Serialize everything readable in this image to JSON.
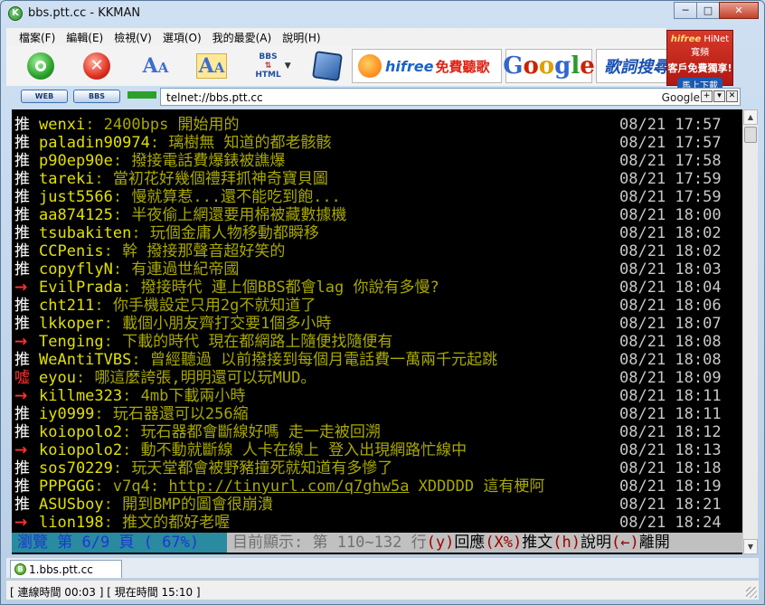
{
  "window": {
    "title": "bbs.ptt.cc - KKMAN",
    "minimize": "─",
    "maximize": "□",
    "close": "✕"
  },
  "menu": [
    "檔案(F)",
    "編輯(E)",
    "檢視(V)",
    "選項(O)",
    "我的最愛(A)",
    "說明(H)"
  ],
  "toolbar": {
    "bbs_html_label": "BBS",
    "bbs_html_label2": "HTML",
    "hifree_brand": "hifree",
    "hifree_text": "免費聽歌",
    "google_ad": "Google",
    "lyric_ad": "歌詞搜尋"
  },
  "banner": {
    "brand": "hifree",
    "line1": "HiNet寬頻",
    "line2": "客戶免費獨享!",
    "cta": "馬上下載"
  },
  "address": {
    "web_label": "WEB",
    "bbs_label": "BBS",
    "value": "telnet://bbs.ptt.cc",
    "search_engine": "Google"
  },
  "posts": [
    {
      "tag": "推",
      "type": "push",
      "user": "wenxi",
      "msg": "2400bps 開始用的",
      "date": "08/21 17:57"
    },
    {
      "tag": "推",
      "type": "push",
      "user": "paladin90974",
      "msg": "璃樹無  知道的都老骸骸",
      "date": "08/21 17:57"
    },
    {
      "tag": "推",
      "type": "push",
      "user": "p90ep90e",
      "msg": "撥接電話費爆錶被譙爆",
      "date": "08/21 17:58"
    },
    {
      "tag": "推",
      "type": "push",
      "user": "tareki",
      "msg": "當初花好幾個禮拜抓神奇寶貝圖",
      "date": "08/21 17:59"
    },
    {
      "tag": "推",
      "type": "push",
      "user": "just5566",
      "msg": "慢就算惹...還不能吃到飽...",
      "date": "08/21 17:59"
    },
    {
      "tag": "推",
      "type": "push",
      "user": "aa874125",
      "msg": "半夜偷上網還要用棉被藏數據機",
      "date": "08/21 18:00"
    },
    {
      "tag": "推",
      "type": "push",
      "user": "tsubakiten",
      "msg": "玩個金庸人物移動都瞬移",
      "date": "08/21 18:02"
    },
    {
      "tag": "推",
      "type": "push",
      "user": "CCPenis",
      "msg": "幹 撥接那聲音超好笑的",
      "date": "08/21 18:02"
    },
    {
      "tag": "推",
      "type": "push",
      "user": "copyflyN",
      "msg": "有連過世紀帝國",
      "date": "08/21 18:03"
    },
    {
      "tag": "→",
      "type": "arrow",
      "user": "EvilPrada",
      "msg": "撥接時代  連上個BBS都會lag  你說有多慢?",
      "date": "08/21 18:04"
    },
    {
      "tag": "推",
      "type": "push",
      "user": "cht211",
      "msg": "你手機設定只用2g不就知道了",
      "date": "08/21 18:06"
    },
    {
      "tag": "推",
      "type": "push",
      "user": "lkkoper",
      "msg": "載個小朋友齊打交要1個多小時",
      "date": "08/21 18:07"
    },
    {
      "tag": "→",
      "type": "arrow",
      "user": "Tenging",
      "msg": "下載的時代 現在都網路上隨便找隨便有",
      "date": "08/21 18:08"
    },
    {
      "tag": "推",
      "type": "push",
      "user": "WeAntiTVBS",
      "msg": "曾經聽過 以前撥接到每個月電話費一萬兩千元起跳",
      "date": "08/21 18:08"
    },
    {
      "tag": "噓",
      "type": "boo",
      "user": "eyou",
      "msg": "哪這麼誇張,明明還可以玩MUD。",
      "date": "08/21 18:09"
    },
    {
      "tag": "→",
      "type": "arrow",
      "user": "killme323",
      "msg": "4mb下載兩小時",
      "date": "08/21 18:11"
    },
    {
      "tag": "推",
      "type": "push",
      "user": "iy0999",
      "msg": "玩石器還可以256縮",
      "date": "08/21 18:11"
    },
    {
      "tag": "推",
      "type": "push",
      "user": "koiopolo2",
      "msg": "玩石器都會斷線好嗎 走一走被回溯",
      "date": "08/21 18:12"
    },
    {
      "tag": "→",
      "type": "arrow",
      "user": "koiopolo2",
      "msg": "動不動就斷線 人卡在線上 登入出現網路忙線中",
      "date": "08/21 18:13"
    },
    {
      "tag": "推",
      "type": "push",
      "user": "sos70229",
      "msg": "玩天堂都會被野豬撞死就知道有多慘了",
      "date": "08/21 18:18"
    },
    {
      "tag": "推",
      "type": "push",
      "user": "PPPGGG",
      "msg_pre": "v7q4: ",
      "link": "http://tinyurl.com/q7ghw5a",
      "msg_post": " XDDDDD 這有梗阿",
      "date": "08/21 18:19"
    },
    {
      "tag": "推",
      "type": "push",
      "user": "ASUSboy",
      "msg": "開到BMP的圖會很崩潰",
      "date": "08/21 18:21"
    },
    {
      "tag": "→",
      "type": "arrow",
      "user": "lion198",
      "msg": "推文的都好老喔",
      "date": "08/21 18:24"
    }
  ],
  "statusline": {
    "left": "瀏覽 第 6/9 頁 ( 67%)",
    "showing": "目前顯示: 第 110~132 行",
    "k1": "(y)",
    "d1": "回應",
    "k2": "(X%)",
    "d2": "推文",
    "k3": "(h)",
    "d3": "說明",
    "k4": "(←)",
    "d4": "離開"
  },
  "tab": {
    "label": "1.bbs.ptt.cc"
  },
  "status": {
    "text": "[ 連線時間 00:03 ] [ 現在時間 15:10 ]"
  }
}
